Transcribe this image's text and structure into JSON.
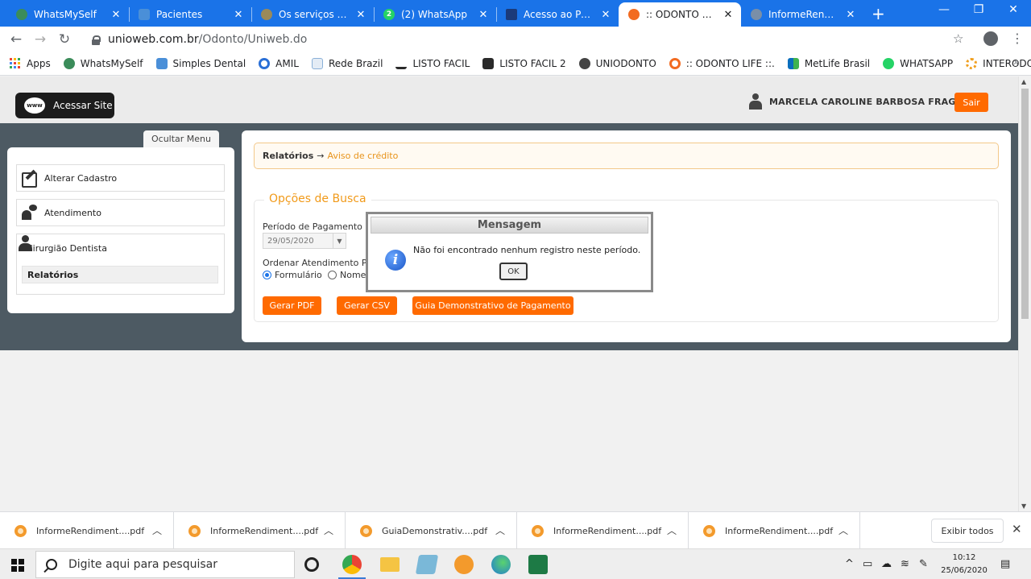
{
  "browser": {
    "tabs": [
      {
        "label": "WhatsMySelf",
        "icon_color": "#3b8c5a"
      },
      {
        "label": "Pacientes",
        "icon_color": "#4a8fd8"
      },
      {
        "label": "Os serviços dos Pl",
        "icon_color": "#9a8a5a"
      },
      {
        "label": "(2) WhatsApp",
        "icon_color": "#25d366"
      },
      {
        "label": "Acesso ao Portal -",
        "icon_color": "#1b3a7a"
      },
      {
        "label": ":: ODONTO LIFE ::.",
        "icon_color": "#f26b21"
      },
      {
        "label": "InformeRendiment",
        "icon_color": "#7a8fa8"
      }
    ],
    "new_tab": "+",
    "window_controls": {
      "minimize": "—",
      "restore": "❐",
      "close": "✕"
    },
    "url_host": "unioweb.com.br",
    "url_path": "/Odonto/Uniweb.do",
    "bookmarks": [
      {
        "label": "Apps",
        "icon": "apps-grid-icon"
      },
      {
        "label": "WhatsMySelf",
        "icon_color": "#3b8c5a"
      },
      {
        "label": "Simples Dental",
        "icon_color": "#4a8fd8"
      },
      {
        "label": "AMIL",
        "icon_color": "#2a6fd6"
      },
      {
        "label": "Rede Brazil",
        "icon_color": "#8ab0d8"
      },
      {
        "label": "LISTO FACIL",
        "icon_color": "#2a2a2a"
      },
      {
        "label": "LISTO FACIL 2",
        "icon_color": "#2a2a2a"
      },
      {
        "label": "UNIODONTO",
        "icon_color": "#444444"
      },
      {
        "label": ":: ODONTO LIFE ::.",
        "icon_color": "#f26b21"
      },
      {
        "label": "MetLife Brasil",
        "icon_color": "#0a6ebd"
      },
      {
        "label": "WHATSAPP",
        "icon_color": "#25d366"
      },
      {
        "label": "INTERODONTO",
        "icon_color": "#f0a020"
      }
    ],
    "bookmarks_more": "»"
  },
  "header": {
    "site_button": "Acessar Site",
    "www_badge": "www",
    "user_name": "MARCELA CAROLINE BARBOSA FRAGA",
    "logout_label": "Sair"
  },
  "sidebar": {
    "toggle_label": "Ocultar Menu",
    "items": [
      {
        "label": "Alterar Cadastro"
      },
      {
        "label": "Atendimento"
      },
      {
        "label": "Cirurgião Dentista"
      }
    ],
    "sub_item": "Relatórios"
  },
  "main": {
    "breadcrumb_root": "Relatórios",
    "breadcrumb_arrow": "→",
    "breadcrumb_current": "Aviso de crédito",
    "search_legend": "Opções de Busca",
    "period_label": "Período de Pagamento",
    "period_value": "29/05/2020",
    "order_label": "Ordenar Atendimento Po",
    "order_options": [
      {
        "label": "Formulário",
        "selected": true
      },
      {
        "label": "Nome",
        "selected": false
      }
    ],
    "buttons": {
      "pdf": "Gerar PDF",
      "csv": "Gerar CSV",
      "guide": "Guia Demonstrativo de Pagamento"
    }
  },
  "modal": {
    "title": "Mensagem",
    "icon_glyph": "i",
    "message": "Não foi encontrado nenhum registro neste período.",
    "ok_label": "OK"
  },
  "downloads": {
    "items": [
      {
        "label": "InformeRendiment....pdf"
      },
      {
        "label": "InformeRendiment....pdf"
      },
      {
        "label": "GuiaDemonstrativ....pdf"
      },
      {
        "label": "InformeRendiment....pdf"
      },
      {
        "label": "InformeRendiment....pdf"
      }
    ],
    "show_all_label": "Exibir todos"
  },
  "taskbar": {
    "search_placeholder": "Digite aqui para pesquisar",
    "time": "10:12",
    "date": "25/06/2020"
  },
  "colors": {
    "accent_orange": "#ff6a00",
    "chrome_blue": "#1a73e8",
    "band_gray": "#4d5a63"
  }
}
